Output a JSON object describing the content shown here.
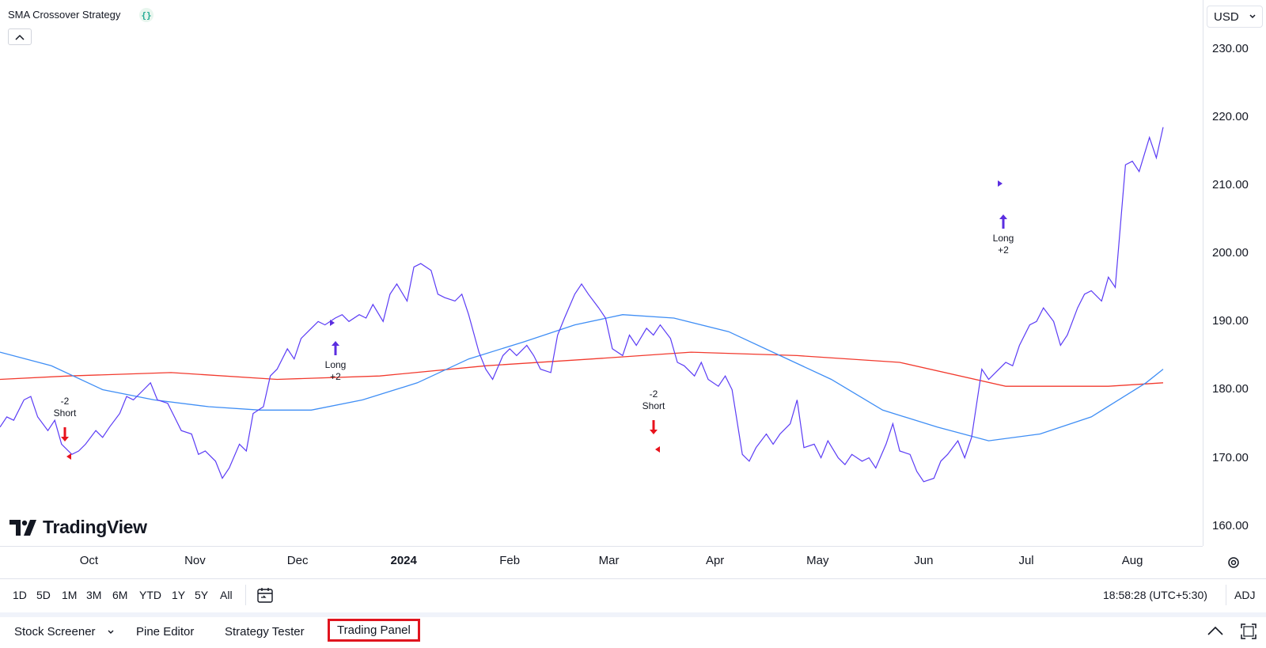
{
  "legend": {
    "title": "SMA Crossover Strategy",
    "icon": "code-braces-icon"
  },
  "currency": {
    "label": "USD"
  },
  "colors": {
    "price": "#5b3cf5",
    "sma_fast": "#3f8ef5",
    "sma_slow": "#f23a2e",
    "long": "#5b2ee0",
    "short": "#e8121c",
    "highlight": "#e0141e"
  },
  "price_axis": {
    "ticks": [
      "230.00",
      "220.00",
      "210.00",
      "200.00",
      "190.00",
      "180.00",
      "170.00",
      "160.00"
    ]
  },
  "time_axis": {
    "ticks": [
      "Oct",
      "Nov",
      "Dec",
      "2024",
      "Feb",
      "Mar",
      "Apr",
      "May",
      "Jun",
      "Jul",
      "Aug"
    ]
  },
  "trades": [
    {
      "side": "Short",
      "qty": "-2",
      "label1": "-2",
      "label2": "Short"
    },
    {
      "side": "Long",
      "qty": "+2",
      "label1": "Long",
      "label2": "+2"
    },
    {
      "side": "Short",
      "qty": "-2",
      "label1": "-2",
      "label2": "Short"
    },
    {
      "side": "Long",
      "qty": "+2",
      "label1": "Long",
      "label2": "+2"
    }
  ],
  "logo": {
    "text": "TradingView"
  },
  "range_buttons": [
    "1D",
    "5D",
    "1M",
    "3M",
    "6M",
    "YTD",
    "1Y",
    "5Y",
    "All"
  ],
  "status": {
    "time": "18:58:28 (UTC+5:30)",
    "adj": "ADJ"
  },
  "bottom_tabs": {
    "stock_screener": "Stock Screener",
    "pine_editor": "Pine Editor",
    "strategy_tester": "Strategy Tester",
    "trading_panel": "Trading Panel"
  },
  "chart_data": {
    "type": "line",
    "x_range": [
      "2023-09-05",
      "2024-08-10"
    ],
    "ylim": [
      158,
      236
    ],
    "series": [
      {
        "name": "price",
        "points": [
          [
            "2023-09-05",
            174.5
          ],
          [
            "2023-09-07",
            176.0
          ],
          [
            "2023-09-09",
            175.5
          ],
          [
            "2023-09-12",
            178.5
          ],
          [
            "2023-09-14",
            179.0
          ],
          [
            "2023-09-16",
            176.0
          ],
          [
            "2023-09-19",
            174.0
          ],
          [
            "2023-09-21",
            175.5
          ],
          [
            "2023-09-23",
            172.0
          ],
          [
            "2023-09-26",
            170.5
          ],
          [
            "2023-09-28",
            171.0
          ],
          [
            "2023-09-30",
            172.0
          ],
          [
            "2023-10-03",
            174.0
          ],
          [
            "2023-10-05",
            173.0
          ],
          [
            "2023-10-07",
            174.5
          ],
          [
            "2023-10-10",
            176.5
          ],
          [
            "2023-10-12",
            179.0
          ],
          [
            "2023-10-14",
            178.5
          ],
          [
            "2023-10-17",
            180.0
          ],
          [
            "2023-10-19",
            181.0
          ],
          [
            "2023-10-21",
            178.5
          ],
          [
            "2023-10-24",
            178.0
          ],
          [
            "2023-10-26",
            176.0
          ],
          [
            "2023-10-28",
            174.0
          ],
          [
            "2023-10-31",
            173.5
          ],
          [
            "2023-11-02",
            170.5
          ],
          [
            "2023-11-04",
            171.0
          ],
          [
            "2023-11-07",
            169.5
          ],
          [
            "2023-11-09",
            167.0
          ],
          [
            "2023-11-11",
            168.5
          ],
          [
            "2023-11-14",
            172.0
          ],
          [
            "2023-11-16",
            171.0
          ],
          [
            "2023-11-18",
            176.5
          ],
          [
            "2023-11-21",
            177.5
          ],
          [
            "2023-11-23",
            182.0
          ],
          [
            "2023-11-25",
            183.0
          ],
          [
            "2023-11-28",
            186.0
          ],
          [
            "2023-11-30",
            184.5
          ],
          [
            "2023-12-02",
            187.5
          ],
          [
            "2023-12-05",
            189.0
          ],
          [
            "2023-12-07",
            190.0
          ],
          [
            "2023-12-09",
            189.5
          ],
          [
            "2023-12-12",
            190.5
          ],
          [
            "2023-12-14",
            191.0
          ],
          [
            "2023-12-16",
            190.0
          ],
          [
            "2023-12-19",
            191.0
          ],
          [
            "2023-12-21",
            190.5
          ],
          [
            "2023-12-23",
            192.5
          ],
          [
            "2023-12-26",
            190.0
          ],
          [
            "2023-12-28",
            194.0
          ],
          [
            "2023-12-30",
            195.5
          ],
          [
            "2024-01-02",
            193.0
          ],
          [
            "2024-01-04",
            198.0
          ],
          [
            "2024-01-06",
            198.5
          ],
          [
            "2024-01-09",
            197.5
          ],
          [
            "2024-01-11",
            194.0
          ],
          [
            "2024-01-13",
            193.5
          ],
          [
            "2024-01-16",
            193.0
          ],
          [
            "2024-01-18",
            194.0
          ],
          [
            "2024-01-20",
            191.0
          ],
          [
            "2024-01-23",
            185.5
          ],
          [
            "2024-01-25",
            183.0
          ],
          [
            "2024-01-27",
            181.5
          ],
          [
            "2024-01-30",
            185.0
          ],
          [
            "2024-02-01",
            186.0
          ],
          [
            "2024-02-03",
            185.0
          ],
          [
            "2024-02-06",
            186.5
          ],
          [
            "2024-02-08",
            185.0
          ],
          [
            "2024-02-10",
            183.0
          ],
          [
            "2024-02-13",
            182.5
          ],
          [
            "2024-02-15",
            188.0
          ],
          [
            "2024-02-17",
            190.5
          ],
          [
            "2024-02-20",
            194.0
          ],
          [
            "2024-02-22",
            195.5
          ],
          [
            "2024-02-24",
            194.0
          ],
          [
            "2024-02-27",
            192.0
          ],
          [
            "2024-02-29",
            190.5
          ],
          [
            "2024-03-02",
            186.0
          ],
          [
            "2024-03-05",
            185.0
          ],
          [
            "2024-03-07",
            188.0
          ],
          [
            "2024-03-09",
            186.5
          ],
          [
            "2024-03-12",
            189.0
          ],
          [
            "2024-03-14",
            188.0
          ],
          [
            "2024-03-16",
            189.5
          ],
          [
            "2024-03-19",
            187.5
          ],
          [
            "2024-03-21",
            184.0
          ],
          [
            "2024-03-23",
            183.5
          ],
          [
            "2024-03-26",
            182.0
          ],
          [
            "2024-03-28",
            184.0
          ],
          [
            "2024-03-30",
            181.5
          ],
          [
            "2024-04-02",
            180.5
          ],
          [
            "2024-04-04",
            182.0
          ],
          [
            "2024-04-06",
            180.0
          ],
          [
            "2024-04-09",
            170.5
          ],
          [
            "2024-04-11",
            169.5
          ],
          [
            "2024-04-13",
            171.5
          ],
          [
            "2024-04-16",
            173.5
          ],
          [
            "2024-04-18",
            172.0
          ],
          [
            "2024-04-20",
            173.5
          ],
          [
            "2024-04-23",
            175.0
          ],
          [
            "2024-04-25",
            178.5
          ],
          [
            "2024-04-27",
            171.5
          ],
          [
            "2024-04-30",
            172.0
          ],
          [
            "2024-05-02",
            170.0
          ],
          [
            "2024-05-04",
            172.5
          ],
          [
            "2024-05-07",
            170.0
          ],
          [
            "2024-05-09",
            169.0
          ],
          [
            "2024-05-11",
            170.5
          ],
          [
            "2024-05-14",
            169.5
          ],
          [
            "2024-05-16",
            170.0
          ],
          [
            "2024-05-18",
            168.5
          ],
          [
            "2024-05-21",
            172.0
          ],
          [
            "2024-05-23",
            175.0
          ],
          [
            "2024-05-25",
            171.0
          ],
          [
            "2024-05-28",
            170.5
          ],
          [
            "2024-05-30",
            168.0
          ],
          [
            "2024-06-01",
            166.5
          ],
          [
            "2024-06-04",
            167.0
          ],
          [
            "2024-06-06",
            169.5
          ],
          [
            "2024-06-08",
            170.5
          ],
          [
            "2024-06-11",
            172.5
          ],
          [
            "2024-06-13",
            170.0
          ],
          [
            "2024-06-15",
            173.0
          ],
          [
            "2024-06-18",
            183.0
          ],
          [
            "2024-06-20",
            181.5
          ],
          [
            "2024-06-22",
            182.5
          ],
          [
            "2024-06-25",
            184.0
          ],
          [
            "2024-06-27",
            183.5
          ],
          [
            "2024-06-29",
            186.5
          ],
          [
            "2024-07-02",
            189.5
          ],
          [
            "2024-07-04",
            190.0
          ],
          [
            "2024-07-06",
            192.0
          ],
          [
            "2024-07-09",
            190.0
          ],
          [
            "2024-07-11",
            186.5
          ],
          [
            "2024-07-13",
            188.0
          ],
          [
            "2024-07-16",
            192.0
          ],
          [
            "2024-07-18",
            194.0
          ],
          [
            "2024-07-20",
            194.5
          ],
          [
            "2024-07-23",
            193.0
          ],
          [
            "2024-07-25",
            196.5
          ],
          [
            "2024-07-27",
            195.0
          ],
          [
            "2024-07-30",
            213.0
          ],
          [
            "2024-08-01",
            213.5
          ],
          [
            "2024-08-03",
            212.0
          ],
          [
            "2024-08-06",
            217.0
          ],
          [
            "2024-08-08",
            214.0
          ],
          [
            "2024-08-10",
            218.5
          ]
        ]
      },
      {
        "name": "sma_fast",
        "points": [
          [
            "2023-09-05",
            185.5
          ],
          [
            "2023-09-20",
            183.5
          ],
          [
            "2023-10-05",
            180.0
          ],
          [
            "2023-10-20",
            178.5
          ],
          [
            "2023-11-05",
            177.5
          ],
          [
            "2023-11-20",
            177.0
          ],
          [
            "2023-12-05",
            177.0
          ],
          [
            "2023-12-20",
            178.5
          ],
          [
            "2024-01-05",
            181.0
          ],
          [
            "2024-01-20",
            184.5
          ],
          [
            "2024-02-05",
            187.0
          ],
          [
            "2024-02-20",
            189.5
          ],
          [
            "2024-03-05",
            191.0
          ],
          [
            "2024-03-20",
            190.5
          ],
          [
            "2024-04-05",
            188.5
          ],
          [
            "2024-04-20",
            185.0
          ],
          [
            "2024-05-05",
            181.5
          ],
          [
            "2024-05-20",
            177.0
          ],
          [
            "2024-06-05",
            174.5
          ],
          [
            "2024-06-20",
            172.5
          ],
          [
            "2024-07-05",
            173.5
          ],
          [
            "2024-07-20",
            176.0
          ],
          [
            "2024-08-05",
            181.0
          ],
          [
            "2024-08-10",
            183.0
          ]
        ]
      },
      {
        "name": "sma_slow",
        "points": [
          [
            "2023-09-05",
            181.5
          ],
          [
            "2023-09-25",
            182.0
          ],
          [
            "2023-10-25",
            182.5
          ],
          [
            "2023-11-25",
            181.5
          ],
          [
            "2023-12-25",
            182.0
          ],
          [
            "2024-01-25",
            183.5
          ],
          [
            "2024-02-25",
            184.5
          ],
          [
            "2024-03-25",
            185.5
          ],
          [
            "2024-04-25",
            185.0
          ],
          [
            "2024-05-25",
            184.0
          ],
          [
            "2024-06-25",
            180.5
          ],
          [
            "2024-07-25",
            180.5
          ],
          [
            "2024-08-10",
            181.0
          ]
        ]
      }
    ]
  }
}
